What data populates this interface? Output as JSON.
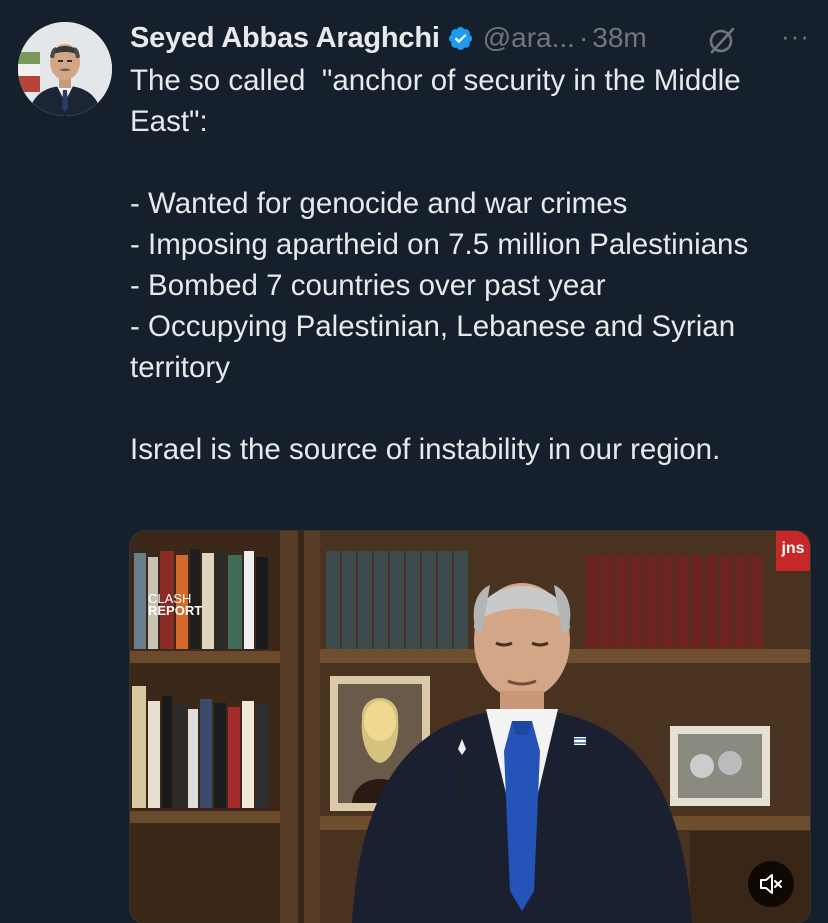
{
  "author": {
    "display_name": "Seyed Abbas Araghchi",
    "handle": "@ara...",
    "separator": "·",
    "time": "38m"
  },
  "tweet": {
    "text": "The so called  \"anchor of security in the Middle East\":\n\n- Wanted for genocide and war crimes\n- Imposing apartheid on 7.5 million Palestinians\n- Bombed 7 countries over past year\n- Occupying Palestinian, Lebanese and Syrian territory\n\nIsrael is the source of instability in our region."
  },
  "media": {
    "watermark_line1": "CLASH",
    "watermark_line2": "REPORT",
    "badge": "jns",
    "mute_icon": "speaker-muted-icon"
  },
  "icons": {
    "verified": "verified-badge-icon",
    "grok": "grok-icon",
    "more": "more-icon"
  },
  "colors": {
    "background": "#16202d",
    "text": "#e7e9ea",
    "muted": "#71767b",
    "verified": "#1d9bf0",
    "badge": "#c62828"
  }
}
